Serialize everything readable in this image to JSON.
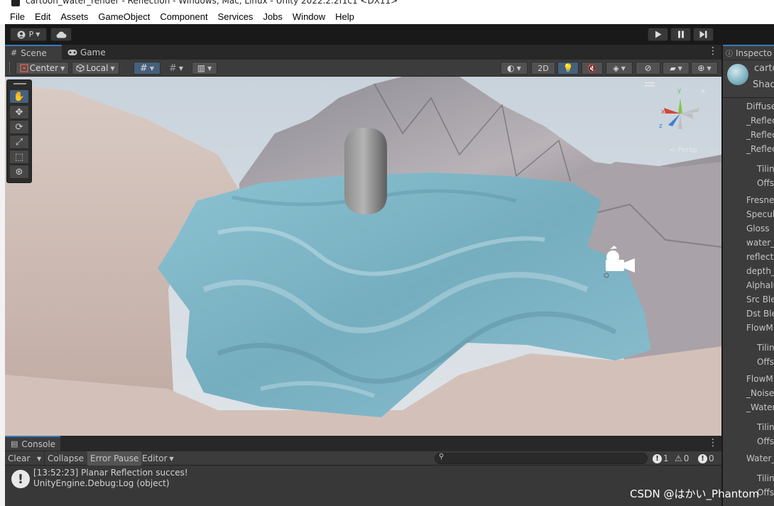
{
  "window": {
    "title": "cartoon_water_render - Reflection - Windows, Mac, Linux - Unity 2022.2.2f1c1 <DX11>"
  },
  "menu": [
    "File",
    "Edit",
    "Assets",
    "GameObject",
    "Component",
    "Services",
    "Jobs",
    "Window",
    "Help"
  ],
  "toolbar": {
    "account_label": "P",
    "account_icon": "account-icon",
    "cloud_icon": "cloud-icon"
  },
  "scene": {
    "tabs": [
      {
        "label": "Scene",
        "icon": "grid-icon",
        "active": true
      },
      {
        "label": "Game",
        "icon": "gamepad-icon",
        "active": false
      }
    ],
    "pivot_label": "Center",
    "space_label": "Local",
    "mode_2d_label": "2D",
    "gizmo_persp_label": "< Persp"
  },
  "tools": [
    "hand-tool-icon",
    "move-tool-icon",
    "rotate-tool-icon",
    "scale-tool-icon",
    "rect-tool-icon",
    "transform-tool-icon"
  ],
  "console": {
    "tab_label": "Console",
    "clear_label": "Clear",
    "collapse_label": "Collapse",
    "error_pause_label": "Error Pause",
    "editor_label": "Editor",
    "search_placeholder": "",
    "counts": {
      "info": "1",
      "warning": "0",
      "error": "0"
    },
    "log": {
      "line1": "[13:52:23] Planar Reflection succes!",
      "line2": "UnityEngine.Debug:Log (object)"
    }
  },
  "inspector": {
    "tab_label": "Inspecto",
    "header_name": "carto",
    "header_sub": "Shad",
    "props": [
      "Diffuse",
      "_Reflec",
      "_Reflec",
      "_Reflec",
      "Tilin",
      "Offs",
      "Fresne",
      "Specul",
      "Gloss",
      "water_",
      "reflecti",
      "depth_",
      "AlphaIn",
      "Src Ble",
      "Dst Ble",
      "FlowM",
      "Tilin",
      "Offs",
      "FlowM",
      "_Noise_",
      "_Water_",
      "Tilin",
      "Offs",
      "Water_",
      "Tilin",
      "Offs"
    ]
  },
  "watermark": "CSDN @はかい_Phantom",
  "colors": {
    "accent": "#3a79bb",
    "panel": "#3c3c3c",
    "water": "#7fb3c6"
  }
}
